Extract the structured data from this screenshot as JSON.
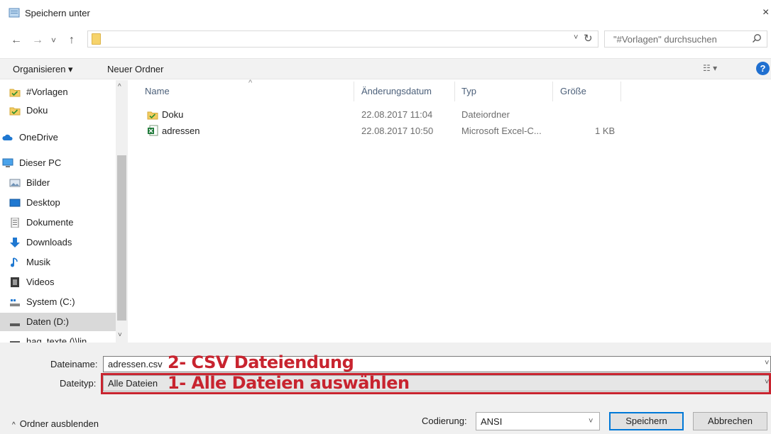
{
  "window": {
    "title": "Speichern unter",
    "close_glyph": "×"
  },
  "nav": {
    "back_glyph": "←",
    "forward_glyph": "→",
    "recent_glyph": "˅",
    "up_glyph": "↑",
    "address_dropdown_glyph": "˅",
    "refresh_glyph": "↻",
    "search_placeholder": "\"#Vorlagen\" durchsuchen",
    "search_icon": "search-icon"
  },
  "toolbar": {
    "organize_label": "Organisieren ▾",
    "new_folder_label": "Neuer Ordner",
    "view_glyph": "☷ ▾",
    "help_glyph": "?"
  },
  "sidebar": {
    "items": [
      {
        "label": "#Vorlagen",
        "icon": "folder-check-icon"
      },
      {
        "label": "Doku",
        "icon": "folder-check-icon"
      },
      {
        "label": "OneDrive",
        "icon": "cloud-icon"
      },
      {
        "label": "Dieser PC",
        "icon": "computer-icon"
      },
      {
        "label": "Bilder",
        "icon": "pictures-icon"
      },
      {
        "label": "Desktop",
        "icon": "desktop-icon"
      },
      {
        "label": "Dokumente",
        "icon": "documents-icon"
      },
      {
        "label": "Downloads",
        "icon": "download-icon"
      },
      {
        "label": "Musik",
        "icon": "music-icon"
      },
      {
        "label": "Videos",
        "icon": "video-icon"
      },
      {
        "label": "System (C:)",
        "icon": "drive-system-icon"
      },
      {
        "label": "Daten (D:)",
        "icon": "drive-icon"
      },
      {
        "label": "hag_texte (\\\\lin",
        "icon": "network-drive-icon"
      }
    ],
    "selected_index": 11,
    "scroll_up_glyph": "^",
    "scroll_down_glyph": "˅"
  },
  "filelist": {
    "columns": [
      "Name",
      "Änderungsdatum",
      "Typ",
      "Größe"
    ],
    "sort_caret": "^",
    "rows": [
      {
        "name": "Doku",
        "date": "22.08.2017 11:04",
        "type": "Dateiordner",
        "size": "",
        "icon": "folder-check-icon"
      },
      {
        "name": "adressen",
        "date": "22.08.2017 10:50",
        "type": "Microsoft Excel-C...",
        "size": "1 KB",
        "icon": "excel-csv-icon"
      }
    ]
  },
  "save": {
    "filename_label": "Dateiname:",
    "filename_value": "adressen.csv",
    "filetype_label": "Dateityp:",
    "filetype_value": "Alle Dateien",
    "dropdown_glyph": "˅"
  },
  "annotations": {
    "step1": "1- Alle Dateien auswählen",
    "step2": "2- CSV Dateiendung",
    "color": "#c8242f"
  },
  "footer": {
    "hide_folders_chevron": "^",
    "hide_folders_label": "Ordner ausblenden",
    "encoding_label": "Codierung:",
    "encoding_value": "ANSI",
    "save_button": "Speichern",
    "cancel_button": "Abbrechen"
  }
}
